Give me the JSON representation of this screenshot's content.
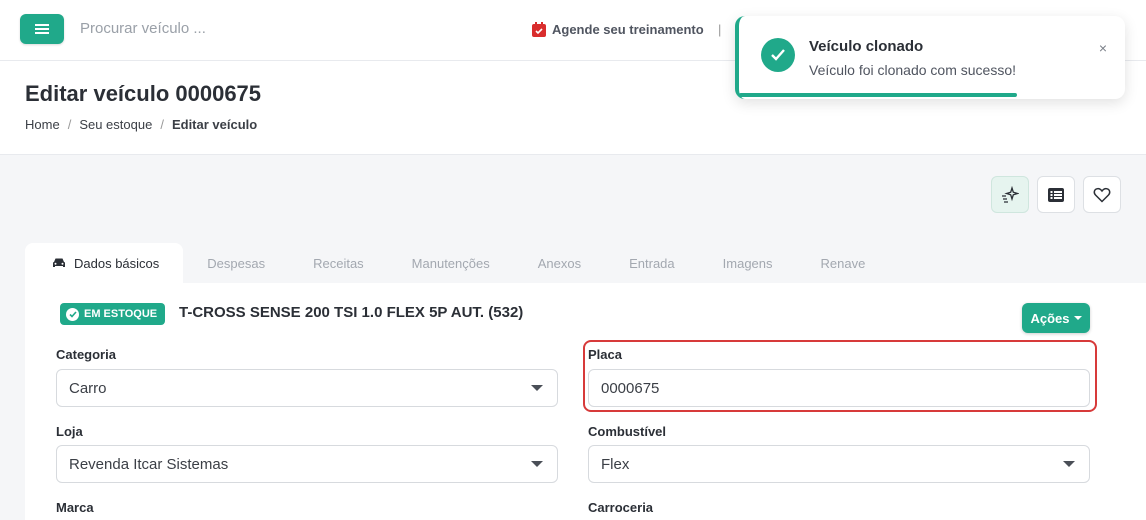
{
  "topbar": {
    "search_placeholder": "Procurar veículo ...",
    "training_label": "Agende seu treinamento",
    "separator": "|"
  },
  "toast": {
    "title": "Veículo clonado",
    "message": "Veículo foi clonado com sucesso!",
    "close": "×",
    "progress": 0.72
  },
  "header": {
    "title": "Editar veículo 0000675",
    "breadcrumb": [
      "Home",
      "Seu estoque",
      "Editar veículo"
    ]
  },
  "tabs": [
    {
      "label": "Dados básicos",
      "active": true
    },
    {
      "label": "Despesas"
    },
    {
      "label": "Receitas"
    },
    {
      "label": "Manutenções"
    },
    {
      "label": "Anexos"
    },
    {
      "label": "Entrada"
    },
    {
      "label": "Imagens"
    },
    {
      "label": "Renave"
    }
  ],
  "vehicle": {
    "status_badge": "EM ESTOQUE",
    "name": "T-CROSS SENSE 200 TSI 1.0 FLEX 5P AUT. (532)",
    "actions_label": "Ações"
  },
  "form": {
    "categoria": {
      "label": "Categoria",
      "value": "Carro"
    },
    "placa": {
      "label": "Placa",
      "value": "0000675"
    },
    "loja": {
      "label": "Loja",
      "value": "Revenda Itcar Sistemas"
    },
    "combustivel": {
      "label": "Combustível",
      "value": "Flex"
    },
    "marca": {
      "label": "Marca"
    },
    "carroceria": {
      "label": "Carroceria"
    }
  },
  "colors": {
    "accent": "#20a98a",
    "highlight": "#d73a3a"
  }
}
